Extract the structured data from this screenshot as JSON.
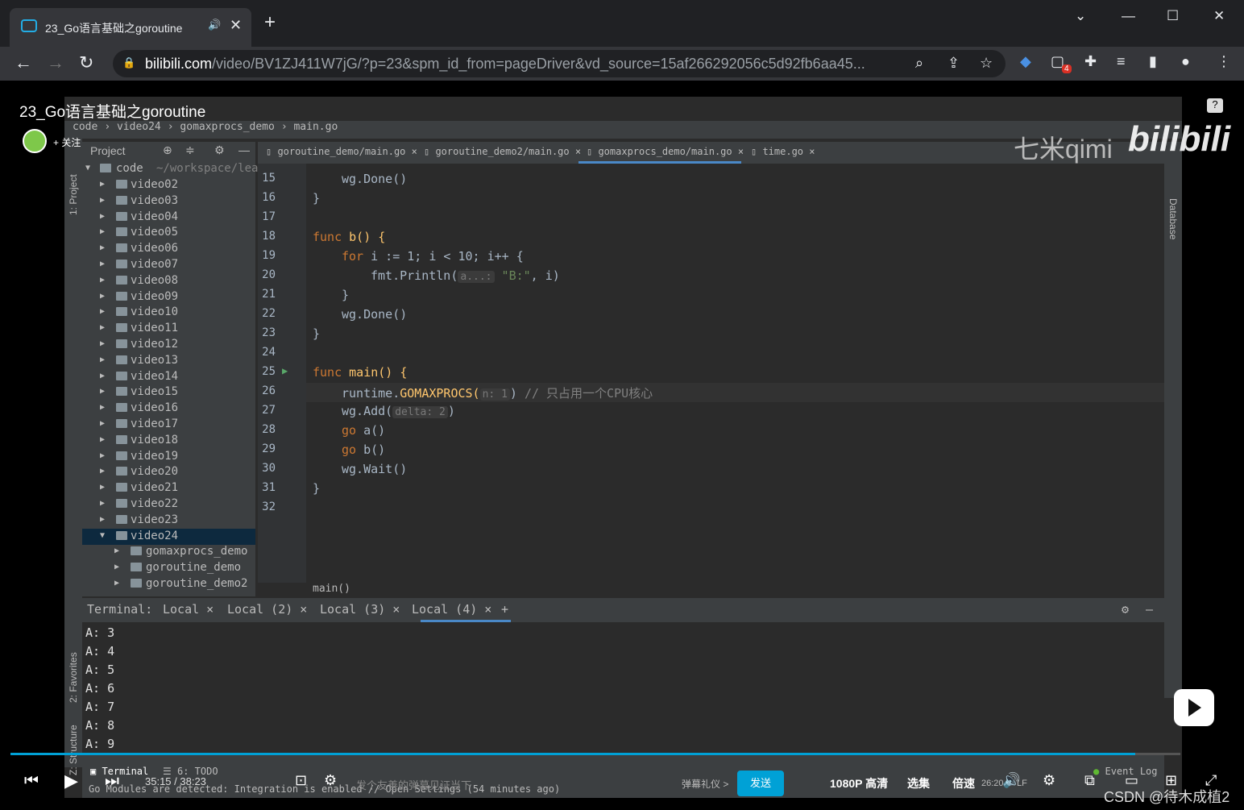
{
  "browser": {
    "tab_title": "23_Go语言基础之goroutine",
    "url_domain": "bilibili.com",
    "url_rest": "/video/BV1ZJ411W7jG/?p=23&spm_id_from=pageDriver&vd_source=15af266292056c5d92fb6aa45...",
    "badge_count": "4"
  },
  "video": {
    "title": "23_Go语言基础之goroutine",
    "follow_label": "+ 关注",
    "help": "?",
    "watermark_qimi": "七米qimi",
    "watermark_bili": "bilibili"
  },
  "ide": {
    "breadcrumb": [
      "code",
      "video24",
      "gomaxprocs_demo",
      "main.go"
    ],
    "project_label": "Project",
    "tree_root": "code",
    "tree_root_path": "~/workspace/lea",
    "tree_items": [
      "video02",
      "video03",
      "video04",
      "video05",
      "video06",
      "video07",
      "video08",
      "video09",
      "video10",
      "video11",
      "video12",
      "video13",
      "video14",
      "video15",
      "video16",
      "video17",
      "video18",
      "video19",
      "video20",
      "video21",
      "video22",
      "video23",
      "video24"
    ],
    "tree_children": [
      "gomaxprocs_demo",
      "goroutine_demo",
      "goroutine_demo2"
    ],
    "editor_tabs": [
      "goroutine_demo/main.go",
      "goroutine_demo2/main.go",
      "gomaxprocs_demo/main.go",
      "time.go"
    ],
    "line_numbers": [
      "15",
      "16",
      "17",
      "18",
      "19",
      "20",
      "21",
      "22",
      "23",
      "24",
      "25",
      "26",
      "27",
      "28",
      "29",
      "30",
      "31",
      "32"
    ],
    "code": {
      "l15": "wg.Done()",
      "l16": "}",
      "l18_kw": "func",
      "l18_fn": "b() {",
      "l19_kw": "for",
      "l19_rest": "i := 1; i < 10; i++ {",
      "l20_call": "fmt.Println(",
      "l20_hint": "a...:",
      "l20_str": "\"B:\"",
      "l20_rest": ", i)",
      "l21": "}",
      "l22": "wg.Done()",
      "l23": "}",
      "l25_kw": "func",
      "l25_fn": "main() {",
      "l26_a": "runtime.",
      "l26_b": "GOMAXPROCS(",
      "l26_hint": "n: 1",
      "l26_c": ")",
      "l26_cmt": "// 只占用一个CPU核心",
      "l27_a": "wg.Add(",
      "l27_hint": "delta: 2",
      "l27_b": ")",
      "l28_kw": "go",
      "l28_rest": "a()",
      "l29_kw": "go",
      "l29_rest": "b()",
      "l30": "wg.Wait()",
      "l31": "}"
    },
    "status_fn": "main()",
    "terminal_label": "Terminal:",
    "terminal_tabs": [
      "Local",
      "Local (2)",
      "Local (3)",
      "Local (4)"
    ],
    "terminal_lines": [
      "A: 3",
      "A: 4",
      "A: 5",
      "A: 6",
      "A: 7",
      "A: 8",
      "A: 9"
    ],
    "side_labels": {
      "project": "1: Project",
      "favorites": "2: Favorites",
      "structure": "Z: Structure",
      "database": "Database"
    },
    "bottom_tabs": {
      "terminal": "Terminal",
      "todo": "6: TODO",
      "event_log": "Event Log"
    },
    "status_msg": "Go Modules are detected: Integration is enabled // Open Settings (54 minutes ago)"
  },
  "player": {
    "time": "35:15 / 38:23",
    "danmaku_placeholder": "发个友善的弹幕见证当下",
    "danmaku_etiquette": "弹幕礼仪 >",
    "send": "发送",
    "quality": "1080P 高清",
    "episodes": "选集",
    "speed": "倍速",
    "ide_time": "26:20",
    "ide_lf": "LF"
  },
  "watermark_csdn": "CSDN @待木成植2"
}
